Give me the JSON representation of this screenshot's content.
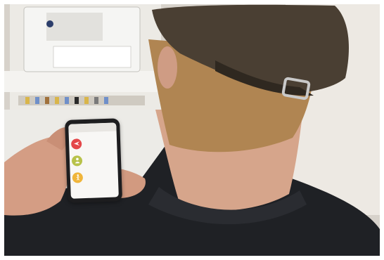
{
  "phone_app": {
    "header_title": "",
    "menu_items": [
      {
        "label": "",
        "icon": "plane-icon",
        "color": "#e4474a"
      },
      {
        "label": "",
        "icon": "person-icon",
        "color": "#b8c24a"
      },
      {
        "label": "",
        "icon": "person-walking-icon",
        "color": "#f0b53a"
      }
    ]
  },
  "colors": {
    "cap": "#4a3f33",
    "hair": "#b08552",
    "shirt": "#1e2024",
    "skin": "#d9a88c"
  }
}
